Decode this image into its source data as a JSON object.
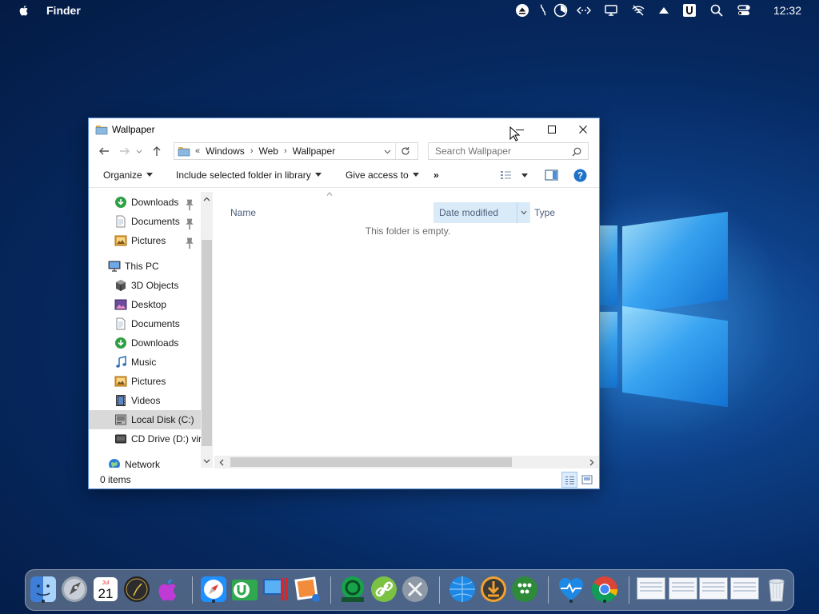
{
  "menubar": {
    "app_name": "Finder",
    "clock": "12:32"
  },
  "window": {
    "title": "Wallpaper",
    "breadcrumbs": [
      "«",
      "Windows",
      "Web",
      "Wallpaper"
    ],
    "search_placeholder": "Search Wallpaper",
    "commands": {
      "organize": "Organize",
      "include": "Include selected folder in library",
      "give_access": "Give access to",
      "more": "»"
    },
    "nav": {
      "quick_downloads": "Downloads",
      "quick_documents": "Documents",
      "quick_pictures": "Pictures",
      "this_pc": "This PC",
      "objects3d": "3D Objects",
      "desktop": "Desktop",
      "documents": "Documents",
      "downloads": "Downloads",
      "music": "Music",
      "pictures": "Pictures",
      "videos": "Videos",
      "local_disk": "Local Disk (C:)",
      "cd_drive": "CD Drive (D:) virt",
      "network": "Network"
    },
    "columns": {
      "name": "Name",
      "date_modified": "Date modified",
      "type": "Type"
    },
    "empty_message": "This folder is empty.",
    "status": "0 items"
  },
  "dock": {
    "calendar_month": "Jul",
    "calendar_day": "21"
  },
  "colors": {
    "accent": "#0078d7",
    "selection": "#d9d9d9",
    "column_active": "#d9ebf9"
  }
}
